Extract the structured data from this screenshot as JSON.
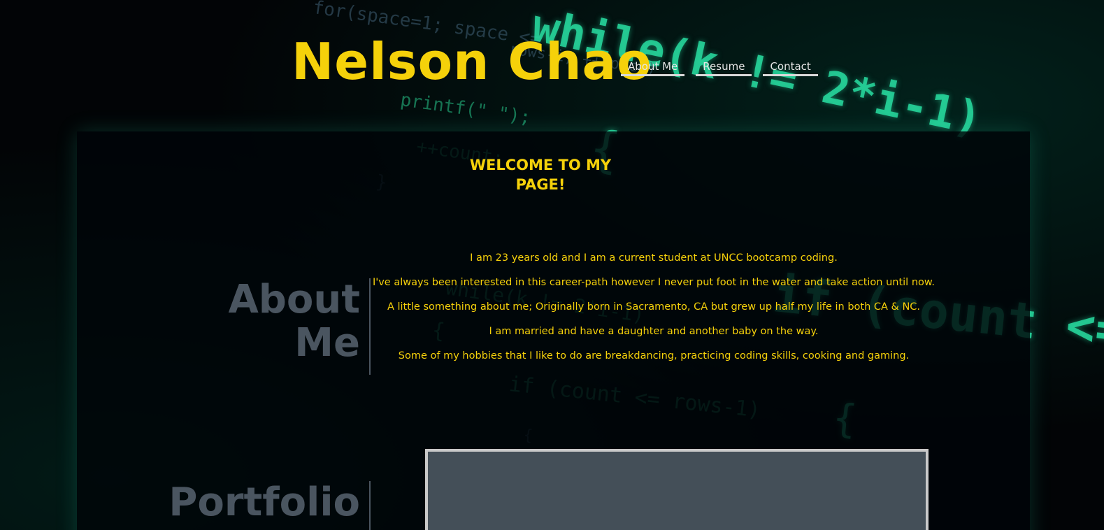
{
  "header": {
    "site_title": "Nelson Chao",
    "nav": [
      {
        "label": "About Me"
      },
      {
        "label": "Resume"
      },
      {
        "label": "Contact"
      }
    ]
  },
  "welcome": {
    "heading": "WELCOME TO MY PAGE!"
  },
  "about": {
    "label": "About Me",
    "paragraphs": [
      "I am 23 years old and I am a current student at UNCC bootcamp coding.",
      "I've always been interested in this career-path however I never put foot in the water and take action until now.",
      "A little something about me; Originally born in Sacramento, CA but grew up half my life in both CA & NC.",
      "I am married and have a daughter and another baby on the way.",
      "Some of my hobbies that I like to do are breakdancing, practicing coding skills, cooking and gaming."
    ]
  },
  "portfolio": {
    "label": "Portfolio"
  },
  "theme": {
    "accent": "#f5d10a",
    "label_gray": "#4a5560",
    "code_green": "#28dca0"
  }
}
